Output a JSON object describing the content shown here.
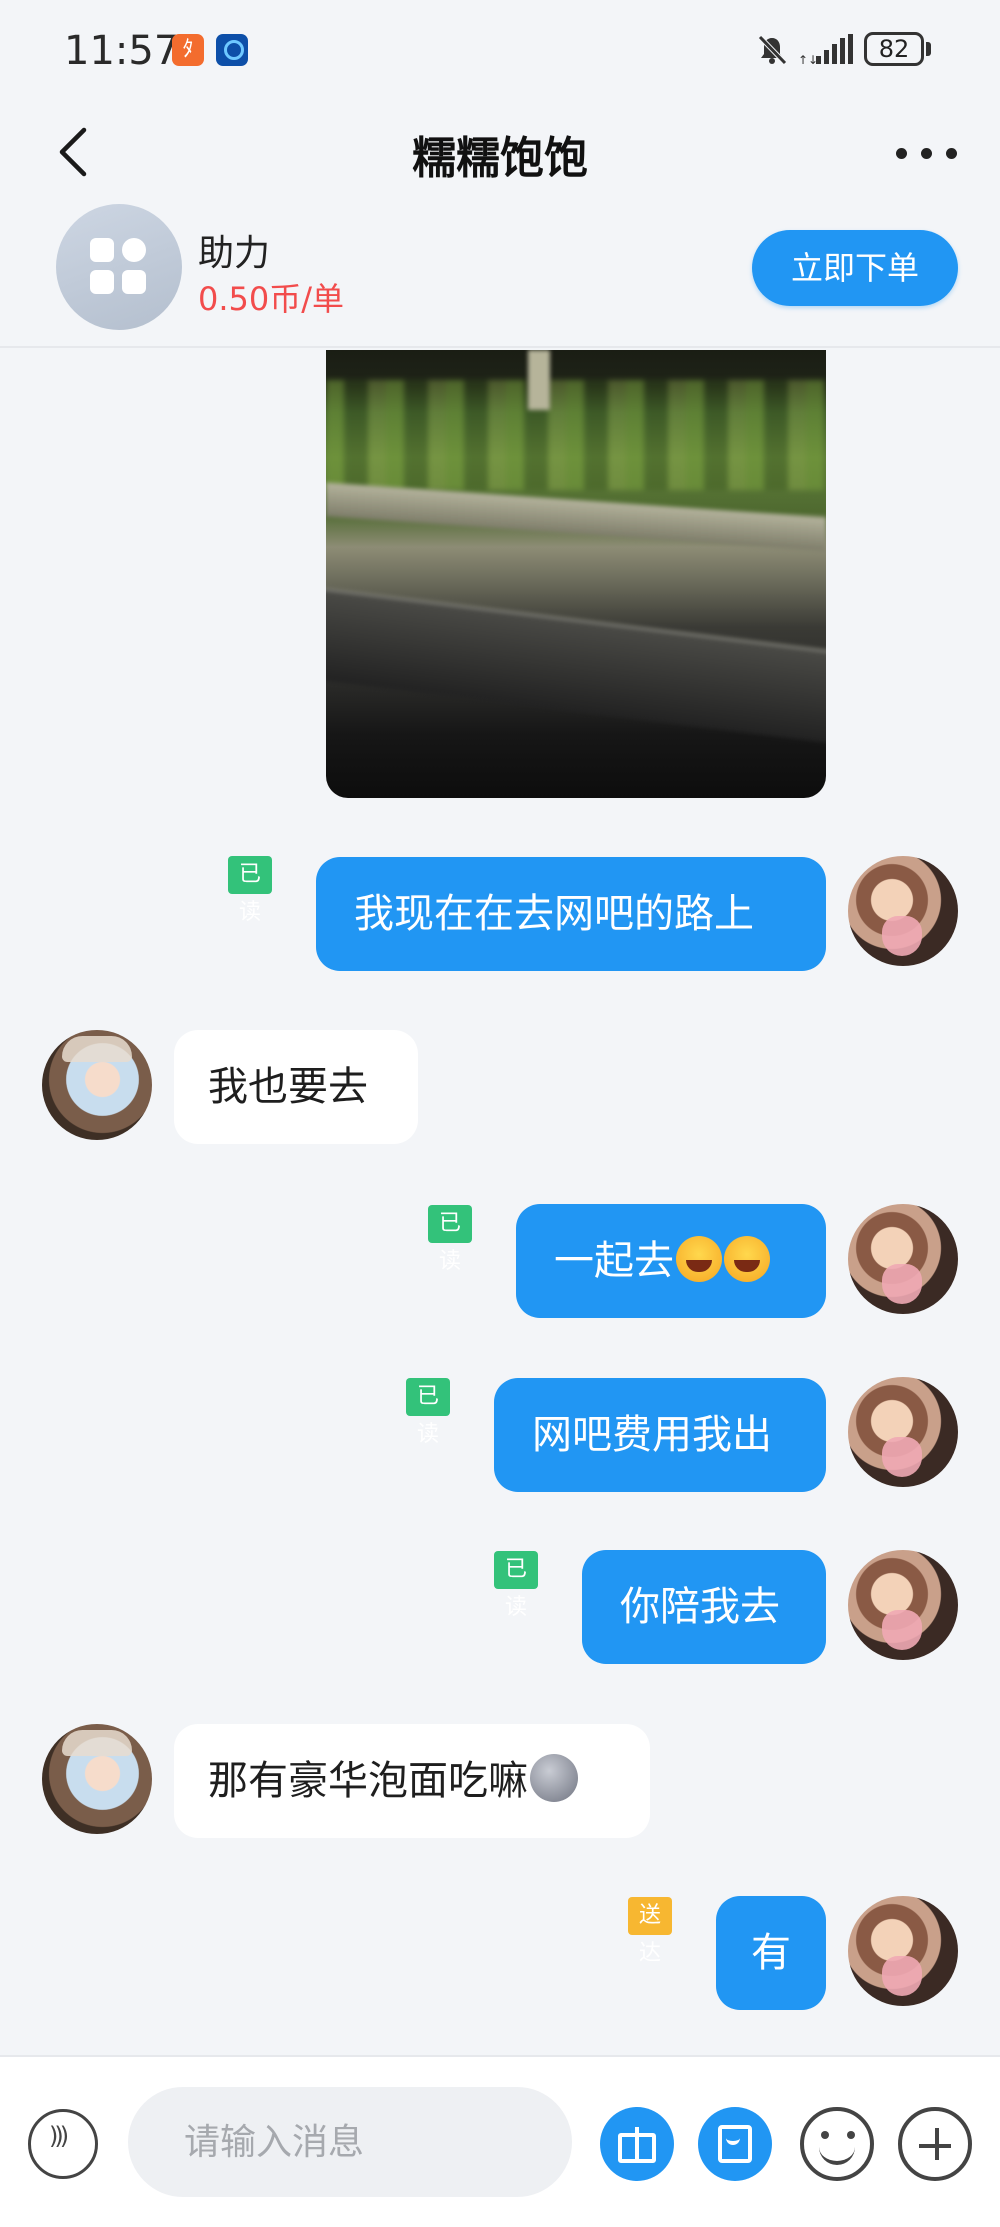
{
  "status_bar": {
    "time": "11:57",
    "battery": "82",
    "app_icon_1": "xiaoman-app-icon",
    "app_icon_2": "blue-app-icon"
  },
  "header": {
    "title": "糯糯饱饱",
    "back_icon": "chevron-left-icon",
    "more_icon": "more-horizontal-icon"
  },
  "service_card": {
    "name": "助力",
    "price": "0.50币/单",
    "order_button": "立即下单",
    "icon": "grid-apps-icon"
  },
  "messages": [
    {
      "from": "me",
      "text": "我现在在去网吧的路上",
      "status": "已读"
    },
    {
      "from": "other",
      "text": "我也要去"
    },
    {
      "from": "me",
      "text": "一起去",
      "emoji": "laughing-emoji",
      "status": "已读"
    },
    {
      "from": "me",
      "text": "网吧费用我出",
      "status": "已读"
    },
    {
      "from": "me",
      "text": "你陪我去",
      "status": "已读"
    },
    {
      "from": "other",
      "text": "那有豪华泡面吃嘛",
      "emoji": "moon-face-emoji"
    },
    {
      "from": "me",
      "text": "有",
      "status": "送达"
    }
  ],
  "input_bar": {
    "placeholder": "请输入消息"
  },
  "colors": {
    "accent": "#2196f3",
    "price": "#f24c4c",
    "read_tag": "#33c27a",
    "sent_tag": "#f7b731",
    "background": "#f3f5f8"
  }
}
